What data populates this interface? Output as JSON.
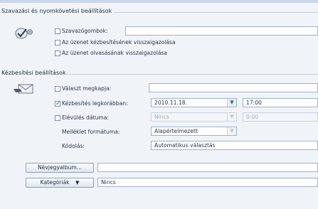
{
  "voting_tracking": {
    "title": "Szavazási és nyomkövetési beállítások",
    "voting_buttons": {
      "label": "Szavazógombok:",
      "checked": false,
      "value": ""
    },
    "delivery_receipt": {
      "label": "Az üzenet kézbesítésének visszaigazolása",
      "checked": false
    },
    "read_receipt": {
      "label": "Az üzenet olvasásának visszaigazolása",
      "checked": false
    }
  },
  "delivery": {
    "title": "Kézbesítési beállítások",
    "reply_to": {
      "label": "Választ megkapja:",
      "checked": false,
      "value": ""
    },
    "deliver_after": {
      "label": "Kézbesítés legkorábban:",
      "checked": true,
      "date": "2010.11.18.",
      "time": "17:00"
    },
    "expires": {
      "label": "Elévülés dátuma:",
      "checked": false,
      "date": "Nincs",
      "time": "0:00"
    },
    "attachment_format": {
      "label": "Melléklet formátuma:",
      "value": "Alapértelmezett"
    },
    "encoding": {
      "label": "Kódolás:",
      "value": "Automatikus választás"
    }
  },
  "contacts": {
    "button_label": "Névjegyalbum...",
    "value": ""
  },
  "categories": {
    "button_label": "Kategóriák",
    "value": "Nincs"
  },
  "icons": {
    "voting": "check-seal-icon",
    "delivery": "envelope-hand-icon",
    "dropdown": "chevron-down-icon"
  }
}
